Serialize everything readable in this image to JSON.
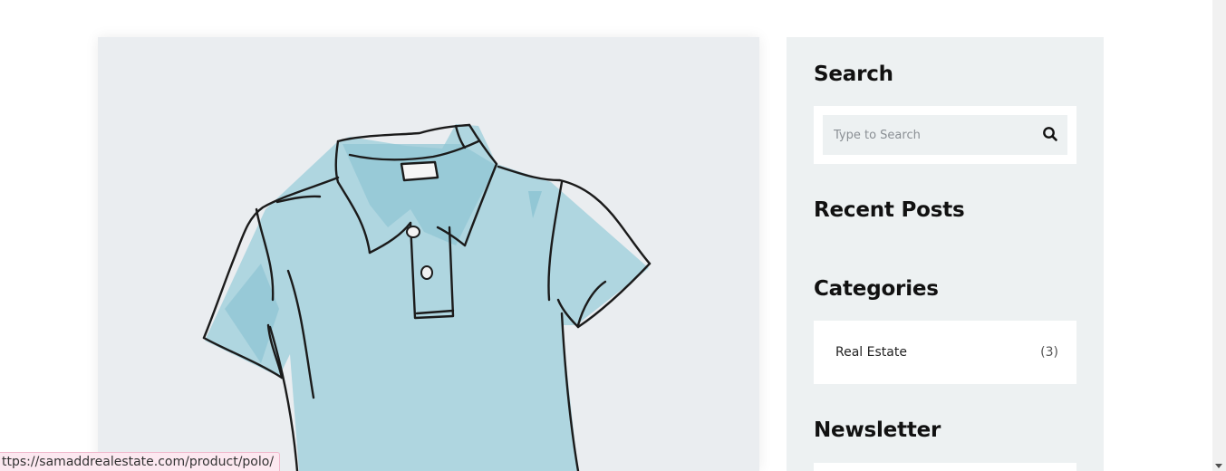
{
  "product": {
    "image_alt": "polo shirt illustration"
  },
  "sidebar": {
    "search": {
      "title": "Search",
      "placeholder": "Type to Search",
      "button_icon": "search-icon"
    },
    "recent_posts": {
      "title": "Recent Posts"
    },
    "categories": {
      "title": "Categories",
      "items": [
        {
          "label": "Real Estate",
          "count": "(3)"
        }
      ]
    },
    "newsletter": {
      "title": "Newsletter"
    }
  },
  "status_bar": {
    "url": "ttps://samaddrealestate.com/product/polo/"
  },
  "colors": {
    "card_bg": "#eaedf0",
    "sidebar_bg": "#edf1f2",
    "shirt_fill": "#a9d3de",
    "shirt_outline": "#1b1b1b"
  }
}
